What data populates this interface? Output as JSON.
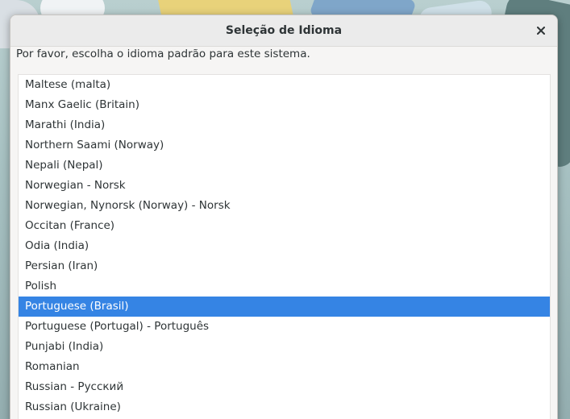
{
  "dialog": {
    "title": "Seleção de Idioma",
    "prompt": "Por favor, escolha o idioma padrão para este sistema."
  },
  "colors": {
    "selection": "#3584e4",
    "text": "#2e3436",
    "dialog_bg": "#f6f5f4"
  },
  "icons": {
    "close": "close-icon"
  },
  "languages": {
    "selected_index": 11,
    "items": [
      "Maltese (malta)",
      "Manx Gaelic (Britain)",
      "Marathi (India)",
      "Northern Saami (Norway)",
      "Nepali (Nepal)",
      "Norwegian - Norsk",
      "Norwegian, Nynorsk (Norway) - Norsk",
      "Occitan (France)",
      "Odia (India)",
      "Persian (Iran)",
      "Polish",
      "Portuguese (Brasil)",
      "Portuguese (Portugal) - Português",
      "Punjabi (India)",
      "Romanian",
      "Russian - Русский",
      "Russian (Ukraine)"
    ]
  }
}
